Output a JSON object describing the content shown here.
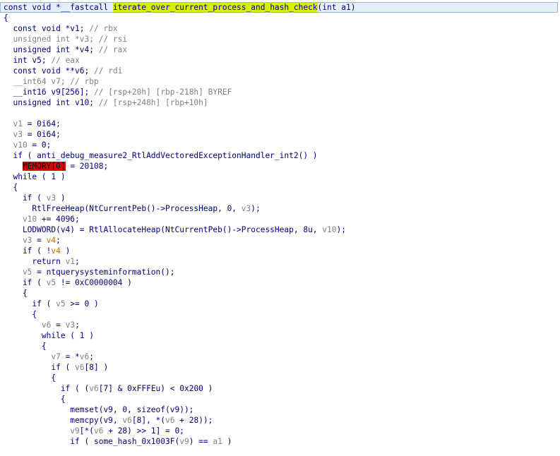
{
  "view": {
    "name": "pseudocode-view",
    "accent": "#d8f000",
    "highlight_bar": "#e6f0fb",
    "error_bg": "#e00000"
  },
  "lines": [
    [
      [
        "c",
        "const void *__fastcall "
      ],
      [
        "hl",
        "iterate_over_current_process_and_hash_check"
      ],
      [
        "c",
        "(int a1)"
      ]
    ],
    [
      [
        "c",
        "{"
      ]
    ],
    [
      [
        "c",
        "  const void *v1; "
      ],
      [
        "g",
        "// rbx"
      ]
    ],
    [
      [
        "g",
        "  unsigned int *v3; // rsi"
      ]
    ],
    [
      [
        "c",
        "  unsigned int *v4; "
      ],
      [
        "g",
        "// rax"
      ]
    ],
    [
      [
        "c",
        "  int v5; "
      ],
      [
        "g",
        "// eax"
      ]
    ],
    [
      [
        "c",
        "  const void **v6; "
      ],
      [
        "g",
        "// rdi"
      ]
    ],
    [
      [
        "g",
        "  __int64 v7; // rbp"
      ]
    ],
    [
      [
        "c",
        "  __int16 v9[256]; "
      ],
      [
        "g",
        "// [rsp+20h] [rbp-218h] BYREF"
      ]
    ],
    [
      [
        "c",
        "  unsigned int v10; "
      ],
      [
        "g",
        "// [rsp+248h] [rbp+10h]"
      ]
    ],
    [
      [
        "c",
        ""
      ]
    ],
    [
      [
        "g",
        "  v1"
      ],
      [
        "c",
        " = 0i64;"
      ]
    ],
    [
      [
        "g",
        "  v3"
      ],
      [
        "c",
        " = 0i64;"
      ]
    ],
    [
      [
        "g",
        "  v10"
      ],
      [
        "c",
        " = 0;"
      ]
    ],
    [
      [
        "c",
        "  if ( anti_debug_measure2_RtlAddVectoredExceptionHandler_int2() )"
      ]
    ],
    [
      [
        "c",
        "    "
      ],
      [
        "err",
        "MEMORY[0]"
      ],
      [
        "c",
        " = 20108;"
      ]
    ],
    [
      [
        "c",
        "  while ( 1 )"
      ]
    ],
    [
      [
        "c",
        "  {"
      ]
    ],
    [
      [
        "c",
        "    if ( "
      ],
      [
        "g",
        "v3"
      ],
      [
        "c",
        " )"
      ]
    ],
    [
      [
        "c",
        "      RtlFreeHeap(NtCurrentPeb()->ProcessHeap, 0, "
      ],
      [
        "g",
        "v3"
      ],
      [
        "c",
        ");"
      ]
    ],
    [
      [
        "g",
        "    v10"
      ],
      [
        "c",
        " += 4096;"
      ]
    ],
    [
      [
        "c",
        "    LODWORD(v4) = RtlAllocateHeap(NtCurrentPeb()->ProcessHeap, 8u, "
      ],
      [
        "g",
        "v10"
      ],
      [
        "c",
        ");"
      ]
    ],
    [
      [
        "g",
        "    v3"
      ],
      [
        "c",
        " = "
      ],
      [
        "o",
        "v4"
      ],
      [
        "c",
        ";"
      ]
    ],
    [
      [
        "c",
        "    if ( !"
      ],
      [
        "o",
        "v4"
      ],
      [
        "c",
        " )"
      ]
    ],
    [
      [
        "c",
        "      return "
      ],
      [
        "g",
        "v1"
      ],
      [
        "c",
        ";"
      ]
    ],
    [
      [
        "g",
        "    v5"
      ],
      [
        "c",
        " = ntquerysysteminformation();"
      ]
    ],
    [
      [
        "c",
        "    if ( "
      ],
      [
        "g",
        "v5"
      ],
      [
        "c",
        " != 0xC0000004 )"
      ]
    ],
    [
      [
        "c",
        "    {"
      ]
    ],
    [
      [
        "c",
        "      if ( "
      ],
      [
        "g",
        "v5"
      ],
      [
        "c",
        " >= 0 )"
      ]
    ],
    [
      [
        "c",
        "      {"
      ]
    ],
    [
      [
        "g",
        "        v6"
      ],
      [
        "c",
        " = "
      ],
      [
        "g",
        "v3"
      ],
      [
        "c",
        ";"
      ]
    ],
    [
      [
        "c",
        "        while ( 1 )"
      ]
    ],
    [
      [
        "c",
        "        {"
      ]
    ],
    [
      [
        "g",
        "          v7"
      ],
      [
        "c",
        " = *"
      ],
      [
        "g",
        "v6"
      ],
      [
        "c",
        ";"
      ]
    ],
    [
      [
        "c",
        "          if ( "
      ],
      [
        "g",
        "v6"
      ],
      [
        "c",
        "[8] )"
      ]
    ],
    [
      [
        "c",
        "          {"
      ]
    ],
    [
      [
        "c",
        "            if ( ("
      ],
      [
        "g",
        "v6"
      ],
      [
        "c",
        "[7] & 0xFFFEu) < 0x200 )"
      ]
    ],
    [
      [
        "c",
        "            {"
      ]
    ],
    [
      [
        "c",
        "              memset(v9, 0, sizeof(v9));"
      ]
    ],
    [
      [
        "c",
        "              memcpy(v9, "
      ],
      [
        "g",
        "v6"
      ],
      [
        "c",
        "[8], *("
      ],
      [
        "g",
        "v6"
      ],
      [
        "c",
        " + 28));"
      ]
    ],
    [
      [
        "g",
        "              v9"
      ],
      [
        "c",
        "[*("
      ],
      [
        "g",
        "v6"
      ],
      [
        "c",
        " + 28) >> 1] = 0;"
      ]
    ],
    [
      [
        "c",
        "              if ( some_hash_0x1003F("
      ],
      [
        "g",
        "v9"
      ],
      [
        "c",
        ") == "
      ],
      [
        "g",
        "a1"
      ],
      [
        "c",
        " )"
      ]
    ]
  ]
}
